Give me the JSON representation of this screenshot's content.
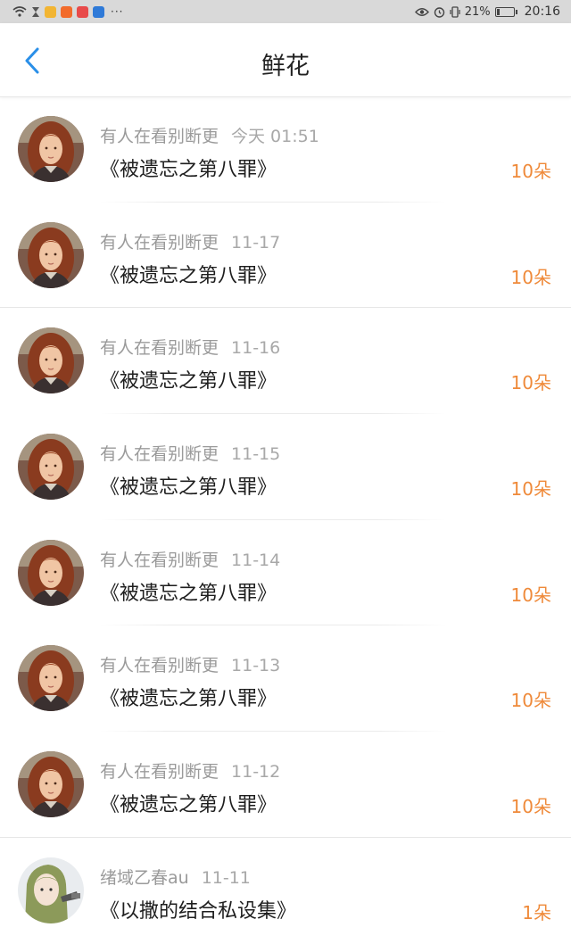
{
  "status_bar": {
    "time": "20:16",
    "battery": "21%",
    "battery_level": 0.21,
    "overflow": "···",
    "icons": [
      "wifi-icon",
      "hourglass-icon",
      "app-icon",
      "play-icon",
      "app-icon",
      "app-icon",
      "eye-icon",
      "alarm-icon",
      "vibrate-icon",
      "battery-icon"
    ]
  },
  "nav": {
    "title": "鲜花",
    "back_icon": "chevron-left-icon"
  },
  "colors": {
    "accent_orange": "#ef8a3a",
    "back_blue": "#2a8fe8"
  },
  "items": [
    {
      "user": "有人在看别断更",
      "date": "今天 01:51",
      "title": "《被遗忘之第八罪》",
      "count": "10朵",
      "avatar": "girl-avatar"
    },
    {
      "user": "有人在看别断更",
      "date": "11-17",
      "title": "《被遗忘之第八罪》",
      "count": "10朵",
      "avatar": "girl-avatar"
    },
    {
      "user": "有人在看别断更",
      "date": "11-16",
      "title": "《被遗忘之第八罪》",
      "count": "10朵",
      "avatar": "girl-avatar"
    },
    {
      "user": "有人在看别断更",
      "date": "11-15",
      "title": "《被遗忘之第八罪》",
      "count": "10朵",
      "avatar": "girl-avatar"
    },
    {
      "user": "有人在看别断更",
      "date": "11-14",
      "title": "《被遗忘之第八罪》",
      "count": "10朵",
      "avatar": "girl-avatar"
    },
    {
      "user": "有人在看别断更",
      "date": "11-13",
      "title": "《被遗忘之第八罪》",
      "count": "10朵",
      "avatar": "girl-avatar"
    },
    {
      "user": "有人在看别断更",
      "date": "11-12",
      "title": "《被遗忘之第八罪》",
      "count": "10朵",
      "avatar": "girl-avatar"
    },
    {
      "user": "绪域乙春au",
      "date": "11-11",
      "title": "《以撒的结合私设集》",
      "count": "1朵",
      "avatar": "anime-avatar"
    }
  ]
}
